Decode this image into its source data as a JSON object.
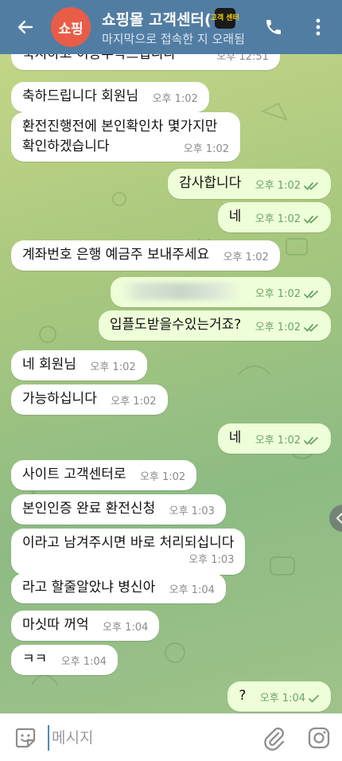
{
  "header": {
    "avatar_text": "쇼핑",
    "title": "쇼핑몰 고객센터(",
    "badge_text": "고객 센터",
    "status": "마지막으로 접속한 지 오래됨"
  },
  "messages": [
    {
      "dir": "in",
      "text": "축지하고 이용부탁드립니다 ^^",
      "time": "오후 12:51"
    },
    {
      "dir": "in",
      "text": "축하드립니다 회원님",
      "time": "오후 1:02"
    },
    {
      "dir": "in",
      "line1": "환전진행전에 본인확인차 몇가지만",
      "line2": "확인하겠습니다",
      "time": "오후 1:02"
    },
    {
      "dir": "out",
      "text": "감사합니다",
      "time": "오후 1:02"
    },
    {
      "dir": "out",
      "text": "네",
      "time": "오후 1:02"
    },
    {
      "dir": "in",
      "text": "계좌번호 은행 예금주 보내주세요",
      "time": "오후 1:02"
    },
    {
      "dir": "out",
      "text": "",
      "time": "오후 1:02"
    },
    {
      "dir": "out",
      "text": "입플도받을수있는거죠?",
      "time": "오후 1:02"
    },
    {
      "dir": "in",
      "text": "네 회원님",
      "time": "오후 1:02"
    },
    {
      "dir": "in",
      "text": "가능하십니다",
      "time": "오후 1:02"
    },
    {
      "dir": "out",
      "text": "네",
      "time": "오후 1:02"
    },
    {
      "dir": "in",
      "text": "사이트 고객센터로",
      "time": "오후 1:02"
    },
    {
      "dir": "in",
      "text": "본인인증 완료 환전신청",
      "time": "오후 1:03"
    },
    {
      "dir": "in",
      "text": "이라고 남겨주시면 바로 처리되십니다",
      "time": "오후 1:03"
    },
    {
      "dir": "in",
      "text": "라고 할줄알았냐 병신아",
      "time": "오후 1:04"
    },
    {
      "dir": "in",
      "text": "마싯따 꺼억",
      "time": "오후 1:04"
    },
    {
      "dir": "in",
      "text": "ㅋㅋ",
      "time": "오후 1:04"
    },
    {
      "dir": "out",
      "text": "?",
      "time": "오후 1:04"
    }
  ],
  "composer": {
    "placeholder": "메시지"
  },
  "colors": {
    "header": "#527da3",
    "incoming_bubble": "#ffffff",
    "outgoing_bubble": "#eefed8",
    "read_check": "#6aa466",
    "avatar": "#e95c47"
  }
}
